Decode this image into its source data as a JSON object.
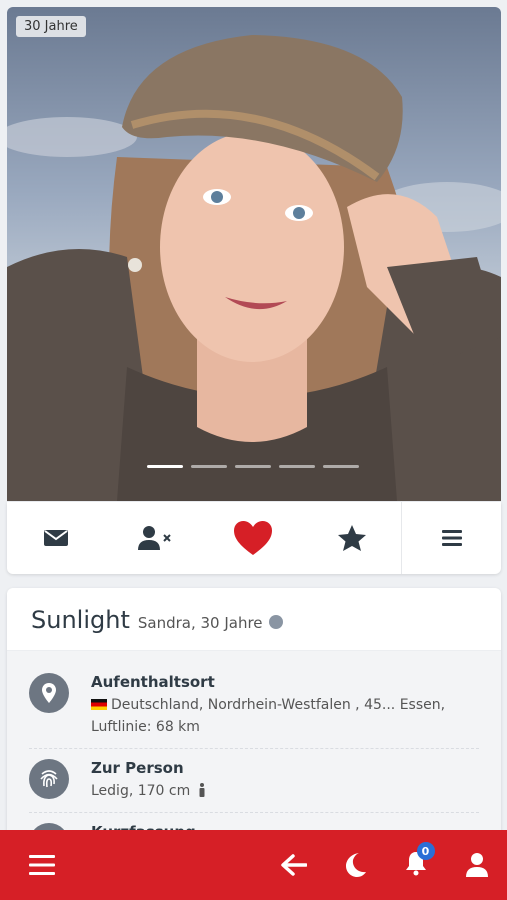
{
  "photo": {
    "age_badge": "30 Jahre",
    "slides_total": 5,
    "slide_active": 1
  },
  "actions": [
    {
      "name": "message",
      "icon": "envelope-icon"
    },
    {
      "name": "remove-contact",
      "icon": "user-x-icon"
    },
    {
      "name": "like",
      "icon": "heart-icon"
    },
    {
      "name": "favorite",
      "icon": "star-icon"
    },
    {
      "name": "more",
      "icon": "menu-icon"
    }
  ],
  "profile": {
    "username": "Sunlight",
    "realname_age": "Sandra, 30 Jahre",
    "status_color": "#8a95a3",
    "location": {
      "title": "Aufenthaltsort",
      "value": "Deutschland, Nordrhein-Westfalen , 45... Essen,",
      "distance": "Luftlinie: 68 km"
    },
    "person": {
      "title": "Zur Person",
      "value": "Ledig, 170 cm"
    },
    "next_title": "Kurzfassung"
  },
  "nav": {
    "notification_count": "0",
    "bar_color": "#d61f26",
    "badge_color": "#2a6fd6"
  },
  "colors": {
    "heart": "#d61f26",
    "icons": "#2f3b45"
  }
}
